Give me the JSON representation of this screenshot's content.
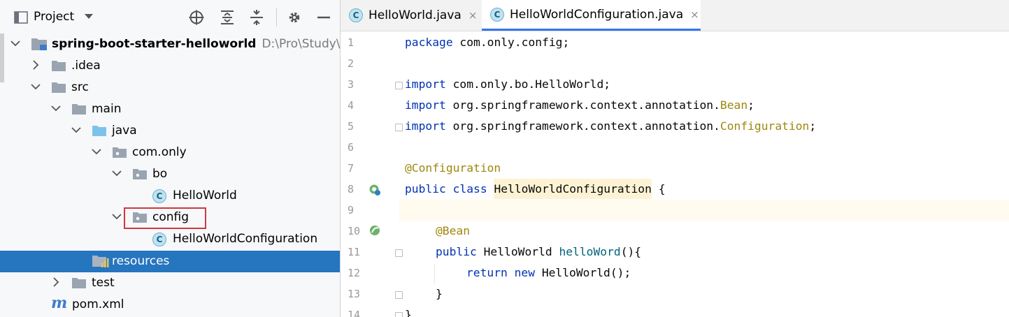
{
  "project_panel": {
    "title": "Project",
    "tree": [
      {
        "label": "spring-boot-starter-helloworld",
        "path": "D:\\Pro\\Study\\spring",
        "bold": true
      },
      {
        "label": ".idea"
      },
      {
        "label": "src"
      },
      {
        "label": "main"
      },
      {
        "label": "java"
      },
      {
        "label": "com.only"
      },
      {
        "label": "bo"
      },
      {
        "label": "HelloWorld"
      },
      {
        "label": "config"
      },
      {
        "label": "HelloWorldConfiguration"
      },
      {
        "label": "resources"
      },
      {
        "label": "test"
      },
      {
        "label": "pom.xml"
      }
    ],
    "class_icon_letter": "C",
    "pom_icon_letter": "m"
  },
  "editor": {
    "tabs": [
      {
        "label": "HelloWorld.java",
        "active": false
      },
      {
        "label": "HelloWorldConfiguration.java",
        "active": true
      }
    ],
    "tab_close": "×",
    "line_numbers": [
      "1",
      "2",
      "3",
      "4",
      "5",
      "6",
      "7",
      "8",
      "9",
      "10",
      "11",
      "12",
      "13",
      "14"
    ],
    "lines": {
      "l1_kw": "package",
      "l1_rest": " com.only.config;",
      "l3_kw": "import",
      "l3_rest": " com.only.bo.HelloWorld;",
      "l4_kw": "import",
      "l4_rest": " org.springframework.context.annotation.",
      "l4_an": "Bean",
      "l4_end": ";",
      "l5_kw": "import",
      "l5_rest": " org.springframework.context.annotation.",
      "l5_an": "Configuration",
      "l5_end": ";",
      "l7_an": "@Configuration",
      "l8_kw": "public class ",
      "l8_cls": "HelloWorldConfiguration",
      "l8_end": " {",
      "l10_an": "@Bean",
      "l11_kw": "public ",
      "l11_rest": "HelloWorld ",
      "l11_m": "helloWord",
      "l11_end": "(){",
      "l12_kw": "return new ",
      "l12_rest": "HelloWorld();",
      "l13": "}",
      "l14": "}"
    }
  },
  "colors": {
    "selection": "#2675bf",
    "highlight_box": "#d3363f",
    "keyword": "#0033b3",
    "annotation": "#9e880d"
  }
}
